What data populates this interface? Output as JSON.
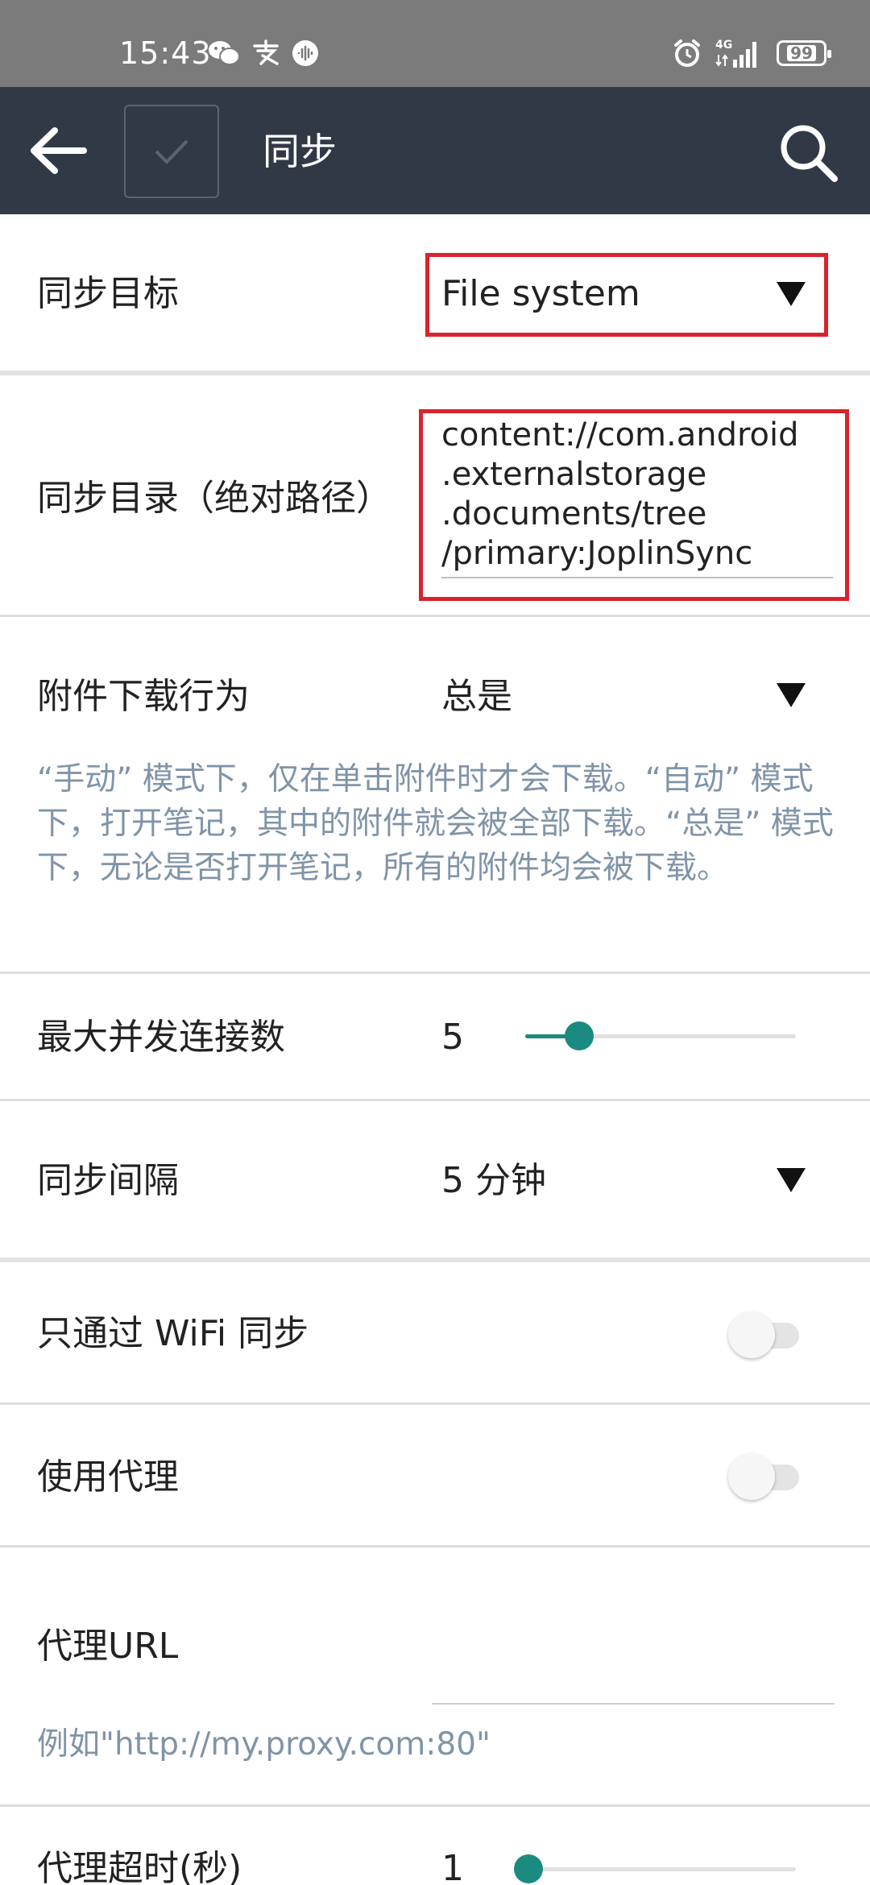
{
  "status_bar": {
    "time": "15:43",
    "left_icons": [
      "wechat-icon",
      "alipay-icon",
      "audio-icon"
    ],
    "right_icons": [
      "alarm-icon",
      "signal-4g-icon"
    ],
    "signal_label": "4G",
    "battery": "99"
  },
  "toolbar": {
    "title": "同步"
  },
  "settings": {
    "sync_target": {
      "label": "同步目标",
      "value": "File system"
    },
    "sync_dir": {
      "label": "同步目录（绝对路径）",
      "lines": [
        "content://com.android",
        ".externalstorage",
        ".documents/tree",
        "/primary:JoplinSync"
      ]
    },
    "attachment_download": {
      "label": "附件下载行为",
      "value": "总是",
      "description": "“手动” 模式下，仅在单击附件时才会下载。“自动” 模式下，打开笔记，其中的附件就会被全部下载。“总是” 模式下，无论是否打开笔记，所有的附件均会被下载。"
    },
    "max_connections": {
      "label": "最大并发连接数",
      "value": "5",
      "slider_fraction": 0.2
    },
    "sync_interval": {
      "label": "同步间隔",
      "value": "5 分钟"
    },
    "wifi_only": {
      "label": "只通过 WiFi 同步",
      "enabled": false
    },
    "use_proxy": {
      "label": "使用代理",
      "enabled": false
    },
    "proxy_url": {
      "label": "代理URL",
      "hint": "例如\"http://my.proxy.com:80\""
    },
    "proxy_timeout": {
      "label": "代理超时(秒)",
      "value": "1",
      "slider_fraction": 0.0
    }
  },
  "colors": {
    "toolbar_bg": "#323946",
    "accent": "#1b8a80",
    "highlight": "#d9232d",
    "hint_text": "#8094a8"
  }
}
